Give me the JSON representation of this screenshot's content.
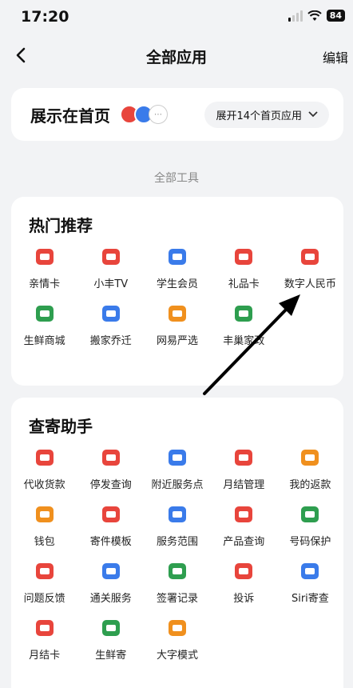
{
  "status": {
    "time": "17:20",
    "battery": "84"
  },
  "nav": {
    "title": "全部应用",
    "edit": "编辑"
  },
  "home": {
    "title": "展示在首页",
    "expand": "展开14个首页应用"
  },
  "section_label": "全部工具",
  "hot": {
    "title": "热门推荐",
    "items": [
      {
        "label": "亲情卡",
        "icon": "card-icon",
        "color": "#e8453c"
      },
      {
        "label": "小丰TV",
        "icon": "tv-icon",
        "color": "#e8453c"
      },
      {
        "label": "学生会员",
        "icon": "graduation-cap-icon",
        "color": "#3a7bea"
      },
      {
        "label": "礼品卡",
        "icon": "gift-card-icon",
        "color": "#e8453c"
      },
      {
        "label": "数字人民币",
        "icon": "digital-yuan-icon",
        "color": "#e8453c"
      },
      {
        "label": "生鲜商城",
        "icon": "fresh-basket-icon",
        "color": "#2e9e4f"
      },
      {
        "label": "搬家乔迁",
        "icon": "moving-truck-icon",
        "color": "#3a7bea"
      },
      {
        "label": "网易严选",
        "icon": "shopping-bag-icon",
        "color": "#f0901e"
      },
      {
        "label": "丰巢家政",
        "icon": "housekeeping-icon",
        "color": "#2e9e4f"
      }
    ]
  },
  "helper": {
    "title": "查寄助手",
    "items": [
      {
        "label": "代收货款",
        "icon": "cod-payment-icon",
        "color": "#e8453c"
      },
      {
        "label": "停发查询",
        "icon": "suspend-query-icon",
        "color": "#e8453c"
      },
      {
        "label": "附近服务点",
        "icon": "nearby-store-icon",
        "color": "#3a7bea"
      },
      {
        "label": "月结管理",
        "icon": "calendar-icon",
        "color": "#e8453c"
      },
      {
        "label": "我的返款",
        "icon": "refund-icon",
        "color": "#f0901e"
      },
      {
        "label": "钱包",
        "icon": "wallet-icon",
        "color": "#f0901e"
      },
      {
        "label": "寄件模板",
        "icon": "template-icon",
        "color": "#e8453c"
      },
      {
        "label": "服务范围",
        "icon": "coverage-icon",
        "color": "#3a7bea"
      },
      {
        "label": "产品查询",
        "icon": "product-search-icon",
        "color": "#e8453c"
      },
      {
        "label": "号码保护",
        "icon": "shield-icon",
        "color": "#2e9e4f"
      },
      {
        "label": "问题反馈",
        "icon": "feedback-icon",
        "color": "#e8453c"
      },
      {
        "label": "通关服务",
        "icon": "customs-icon",
        "color": "#3a7bea"
      },
      {
        "label": "签署记录",
        "icon": "sign-record-icon",
        "color": "#2e9e4f"
      },
      {
        "label": "投诉",
        "icon": "complaint-icon",
        "color": "#e8453c"
      },
      {
        "label": "Siri寄查",
        "icon": "microphone-icon",
        "color": "#3a7bea"
      },
      {
        "label": "月结卡",
        "icon": "monthly-card-icon",
        "color": "#e8453c"
      },
      {
        "label": "生鲜寄",
        "icon": "fresh-send-icon",
        "color": "#2e9e4f"
      },
      {
        "label": "大字模式",
        "icon": "large-font-icon",
        "color": "#f0901e"
      }
    ]
  }
}
